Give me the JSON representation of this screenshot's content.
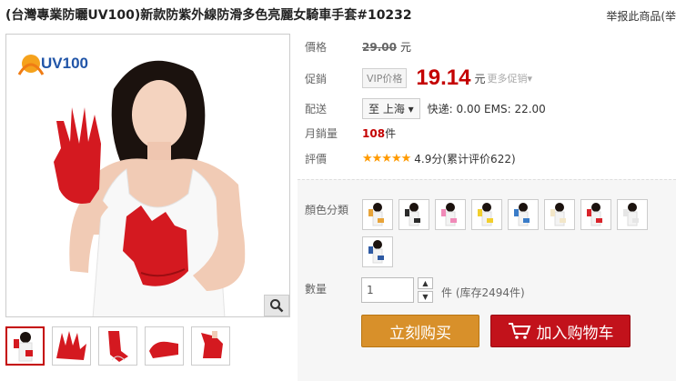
{
  "product": {
    "title": "(台灣專業防曬UV100)新款防紫外線防滑多色亮麗女騎車手套#10232",
    "report_link": "举报此商品(举"
  },
  "main_image": {
    "logo_text": "UV100",
    "zoom_icon": "magnifier-icon"
  },
  "thumbnails": [
    {
      "active": true
    },
    {
      "active": false
    },
    {
      "active": false
    },
    {
      "active": false
    },
    {
      "active": false
    }
  ],
  "info": {
    "price_label": "價格",
    "original_price": "29.00",
    "currency": "元",
    "promo_label": "促銷",
    "vip_label": "VIP价格",
    "promo_price": "19.14",
    "more_promo": "更多促销▾",
    "shipping_label": "配送",
    "destination": "至 上海 ▾",
    "shipping_fee": "快递: 0.00 EMS: 22.00",
    "monthly_label": "月銷量",
    "monthly_sales": "108",
    "sales_unit": "件",
    "rating_label": "評價",
    "stars": "★★★★★",
    "rating": "4.9分",
    "review_count": "(累计评价622)"
  },
  "sku": {
    "color_label": "顏色分類",
    "swatch_colors": [
      "#e8a43a",
      "#2b2b2b",
      "#f08ab8",
      "#f2cf2d",
      "#3a7cc8",
      "#f3e7c9",
      "#d9242b",
      "#e6e6e6",
      "#2e5aa3"
    ],
    "qty_label": "數量",
    "qty_value": "1",
    "stock_text": "件 (库存2494件)"
  },
  "buttons": {
    "buy_now": "立刻购买",
    "add_to_cart": "加入购物车"
  },
  "colors": {
    "price_red": "#c40000",
    "buy_orange": "#d8902a",
    "cart_red": "#c2121b",
    "star_orange": "#ff9a00"
  }
}
